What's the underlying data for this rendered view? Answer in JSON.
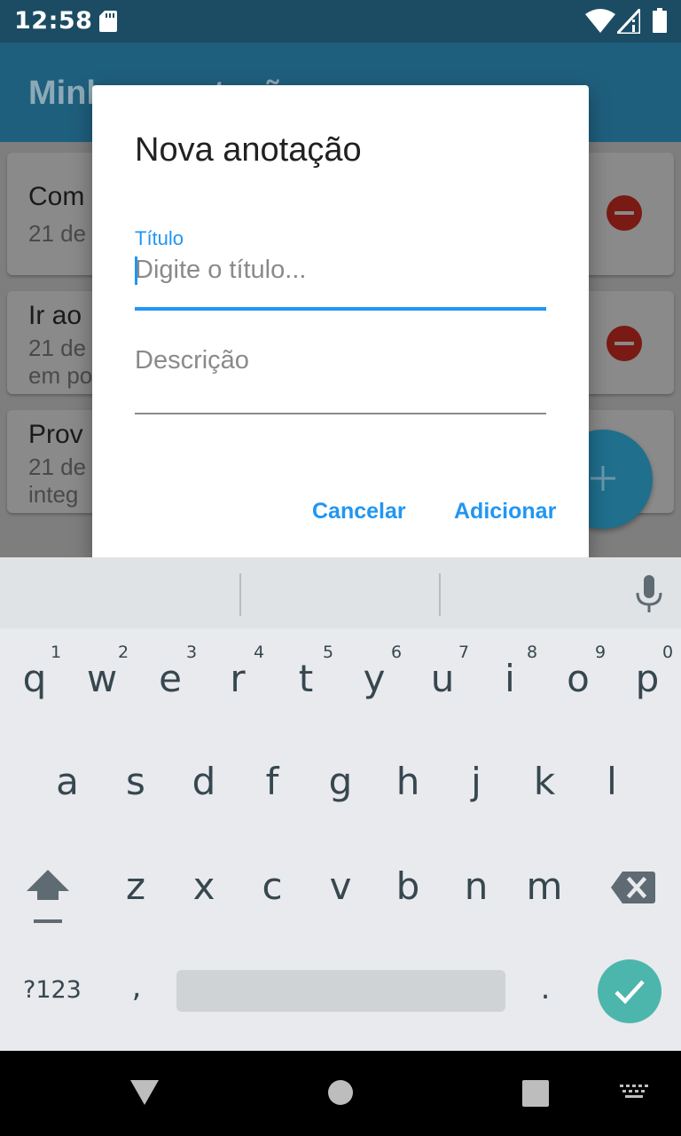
{
  "status_bar": {
    "time": "12:58",
    "icons": [
      "sd-card-icon",
      "wifi-icon",
      "signal-icon",
      "battery-icon"
    ]
  },
  "app_bar": {
    "title": "Minhas anotações"
  },
  "notes": [
    {
      "title": "Com",
      "subtitle_lines": [
        "21 de"
      ]
    },
    {
      "title": "Ir ao",
      "subtitle_lines": [
        "21 de",
        "em po"
      ]
    },
    {
      "title": "Prov",
      "subtitle_lines": [
        "21 de",
        "integ"
      ]
    }
  ],
  "dialog": {
    "title": "Nova anotação",
    "title_field": {
      "label": "Título",
      "placeholder": "Digite o título...",
      "value": ""
    },
    "description_field": {
      "placeholder": "Descrição",
      "value": ""
    },
    "cancel_label": "Cancelar",
    "confirm_label": "Adicionar"
  },
  "keyboard": {
    "row1": [
      "q",
      "w",
      "e",
      "r",
      "t",
      "y",
      "u",
      "i",
      "o",
      "p"
    ],
    "row1_hints": [
      "1",
      "2",
      "3",
      "4",
      "5",
      "6",
      "7",
      "8",
      "9",
      "0"
    ],
    "row2": [
      "a",
      "s",
      "d",
      "f",
      "g",
      "h",
      "j",
      "k",
      "l"
    ],
    "row3": [
      "z",
      "x",
      "c",
      "v",
      "b",
      "n",
      "m"
    ],
    "symbols_label": "?123",
    "comma": ",",
    "period": "."
  },
  "colors": {
    "accent": "#2196f3",
    "status_bar": "#1b4c63",
    "app_bar": "#1f5f7e",
    "keyboard_bg": "#e8eaed",
    "enter_key": "#4db6ac"
  }
}
